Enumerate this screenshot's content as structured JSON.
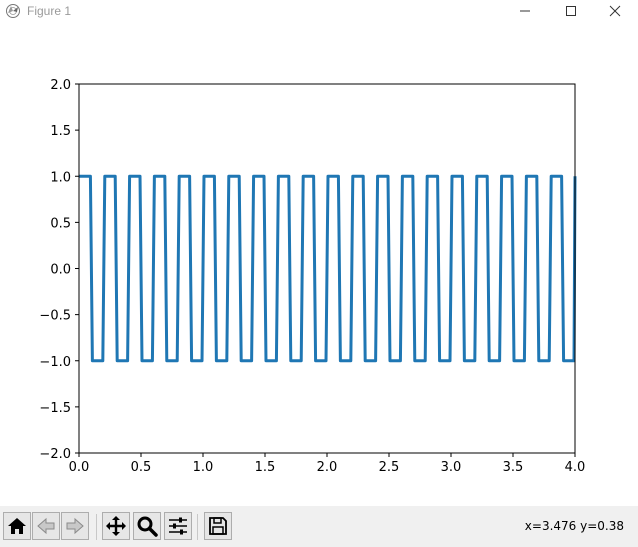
{
  "window": {
    "title": "Figure 1"
  },
  "toolbar": {
    "buttons": [
      {
        "name": "home",
        "icon": "home-icon"
      },
      {
        "name": "back",
        "icon": "arrow-left-icon"
      },
      {
        "name": "forward",
        "icon": "arrow-right-icon"
      },
      {
        "name": "pan",
        "icon": "move-icon"
      },
      {
        "name": "zoom",
        "icon": "magnifier-icon"
      },
      {
        "name": "configure",
        "icon": "sliders-icon"
      },
      {
        "name": "save",
        "icon": "floppy-disk-icon"
      }
    ],
    "coordinates": "x=3.476 y=0.38"
  },
  "colors": {
    "line": "#1f77b4",
    "toolbar_bg": "#f0f0f0"
  },
  "chart_data": {
    "type": "line",
    "title": "",
    "xlabel": "",
    "ylabel": "",
    "xlim": [
      0.0,
      4.0
    ],
    "ylim": [
      -2.0,
      2.0
    ],
    "x_ticks": [
      "0.0",
      "0.5",
      "1.0",
      "1.5",
      "2.0",
      "2.5",
      "3.0",
      "3.5",
      "4.0"
    ],
    "y_ticks": [
      "2.0",
      "1.5",
      "1.0",
      "0.5",
      "0.0",
      "−0.5",
      "−1.0",
      "−1.5",
      "−2.0"
    ],
    "grid": false,
    "series": [
      {
        "waveform": "square",
        "frequency": 5,
        "amplitude": 1.0,
        "x_range": [
          0.0,
          4.0
        ],
        "color": "#1f77b4"
      }
    ]
  }
}
